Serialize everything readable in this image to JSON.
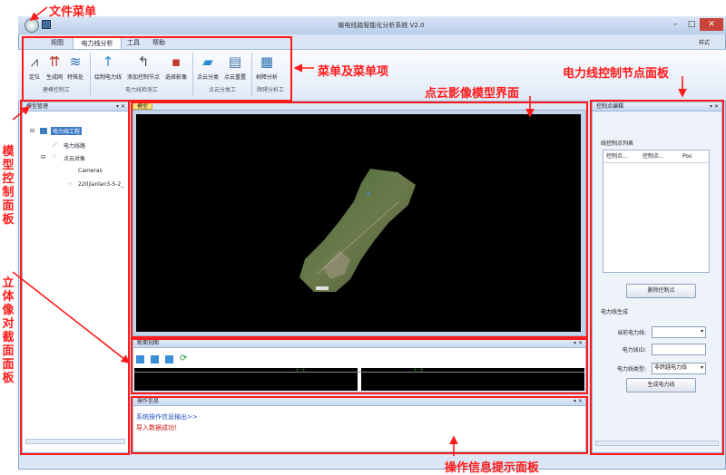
{
  "window": {
    "title": "输电线路智能化分析系统 V2.0",
    "style_label": "样式",
    "min": "–",
    "max": "□",
    "close": "✕"
  },
  "tabs": [
    {
      "label": "视图",
      "active": false
    },
    {
      "label": "电力线分析",
      "active": true
    },
    {
      "label": "工具",
      "active": false
    },
    {
      "label": "帮助",
      "active": false
    }
  ],
  "ribbon": {
    "buttons": [
      {
        "label": "定位",
        "icon": "tower-icon",
        "glyph": "⩘",
        "color": "#555"
      },
      {
        "label": "生成网",
        "icon": "grid-icon",
        "glyph": "⇈",
        "color": "#c0392b"
      },
      {
        "label": "特殊处",
        "icon": "lines-icon",
        "glyph": "≋",
        "color": "#2a6fb0"
      },
      {
        "label": "绘制电力线",
        "icon": "arrow-up-icon",
        "glyph": "↑",
        "color": "#2a8fd0"
      },
      {
        "label": "添加控制节点",
        "icon": "curve-arrow-icon",
        "glyph": "↰",
        "color": "#444"
      },
      {
        "label": "选择影像",
        "icon": "image-select-icon",
        "glyph": "▪",
        "color": "#c0392b"
      },
      {
        "label": "点云分类",
        "icon": "folder-icon",
        "glyph": "▰",
        "color": "#2a8fd0"
      },
      {
        "label": "点云重置",
        "icon": "layers-icon",
        "glyph": "▤",
        "color": "#3f6fa0"
      },
      {
        "label": "树障分析",
        "icon": "report-icon",
        "glyph": "▦",
        "color": "#2a6fb0"
      }
    ],
    "groups": [
      "建模控制工",
      "电力线检测工",
      "点云分类工",
      "障碍分析工"
    ]
  },
  "left_panel": {
    "title": "模型管理",
    "tree": [
      {
        "label": "电力线工程",
        "selected": true
      },
      {
        "label": "电力线路",
        "selected": false
      },
      {
        "label": "点云对象",
        "selected": false
      },
      {
        "label": "Cameras",
        "selected": false
      },
      {
        "label": "220jianlan3-5-2_",
        "selected": false
      }
    ]
  },
  "viewport": {
    "tab": "模型"
  },
  "section_view": {
    "title": "断面视图",
    "marker_left": "+ +",
    "marker_right": "+ +"
  },
  "log_panel": {
    "title": "操作信息",
    "lines": [
      "系统操作信息输出>>",
      "导入数据成功！"
    ],
    "colors": [
      "#2050c0",
      "#d01010"
    ]
  },
  "right_panel": {
    "title": "控制点编辑",
    "list_title": "线控制点列表",
    "columns": [
      "控制点...",
      "控制点...",
      "Pos"
    ],
    "delete_button": "删除控制点",
    "gen_title": "电力线生成",
    "current_label": "当前电力线:",
    "id_label": "电力线ID:",
    "type_label": "电力线类型:",
    "type_value": "非跨越电力线",
    "generate_button": "生成电力线"
  },
  "annotations": {
    "file_menu": "文件菜单",
    "menu": "菜单及菜单项",
    "viewport": "点云影像模型界面",
    "control_panel": "电力线控制节点面板",
    "model_panel": "模型控制面板",
    "section_panel": "立体像对截面面板",
    "info_panel": "操作信息提示面板"
  }
}
